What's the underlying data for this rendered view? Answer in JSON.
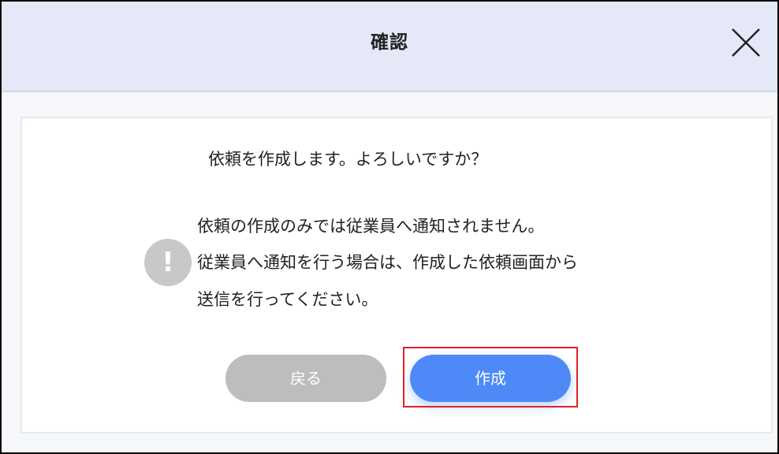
{
  "dialog": {
    "title": "確認",
    "close_icon": "close-icon"
  },
  "body": {
    "question": "依頼を作成します。よろしいですか？",
    "alert_icon": "exclamation-icon",
    "alert_symbol": "!",
    "message_lines": [
      "依頼の作成のみでは従業員へ通知されません。",
      "従業員へ通知を行う場合は、作成した依頼画面から",
      "送信を行ってください。"
    ]
  },
  "buttons": {
    "back_label": "戻る",
    "create_label": "作成"
  },
  "colors": {
    "header_bg": "#e5e9f7",
    "primary": "#4d8af7",
    "secondary": "#bdbdbd",
    "highlight": "#e0202a"
  }
}
